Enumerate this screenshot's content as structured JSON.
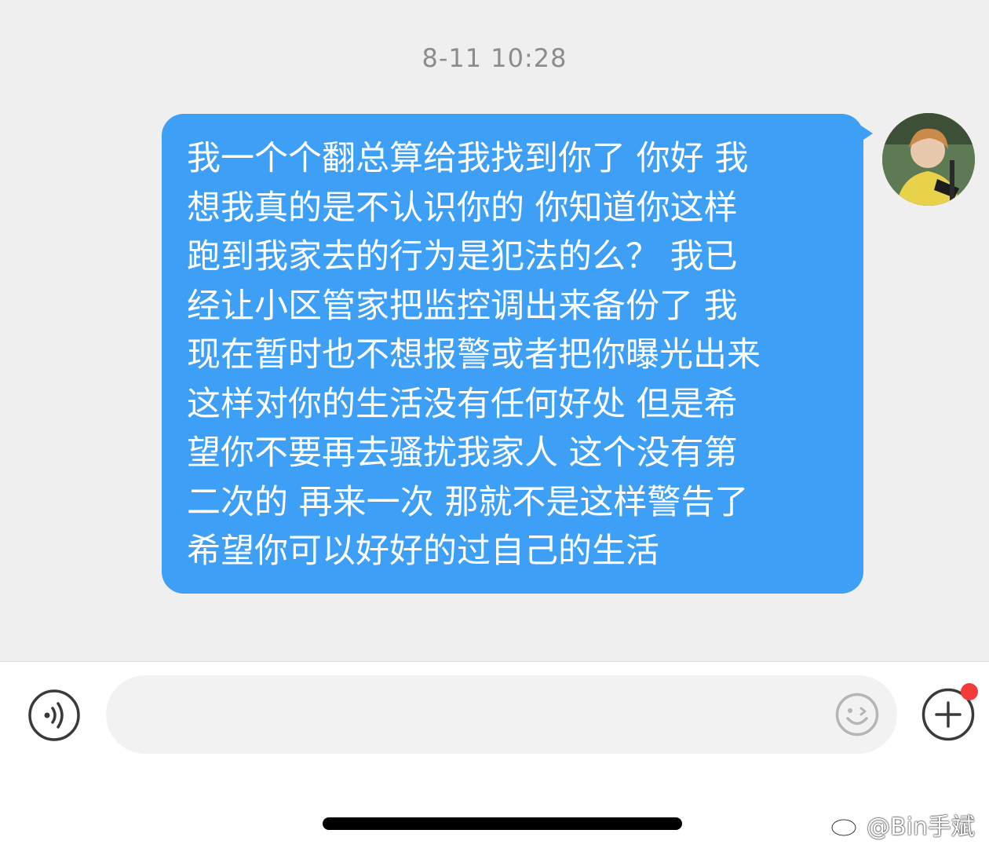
{
  "chat": {
    "timestamp": "8-11 10:28",
    "message_lines": [
      "我一个个翻总算给我找到你了 你好 我",
      "想我真的是不认识你的 你知道你这样",
      "跑到我家去的行为是犯法的么？ 我已",
      "经让小区管家把监控调出来备份了 我",
      "现在暂时也不想报警或者把你曝光出来",
      "这样对你的生活没有任何好处 但是希",
      "望你不要再去骚扰我家人 这个没有第",
      "二次的 再来一次 那就不是这样警告了",
      "希望你可以好好的过自己的生活"
    ],
    "bubble_color": "#3d9ff5",
    "background_color": "#efefef"
  },
  "input_bar": {
    "text_value": "",
    "placeholder": "",
    "voice_icon": "voice-icon",
    "emoji_icon": "emoji-icon",
    "plus_icon": "plus-icon",
    "notification_color": "#f23c3c"
  },
  "watermark": {
    "text": "@Bin手斌",
    "logo": "weibo-logo"
  }
}
